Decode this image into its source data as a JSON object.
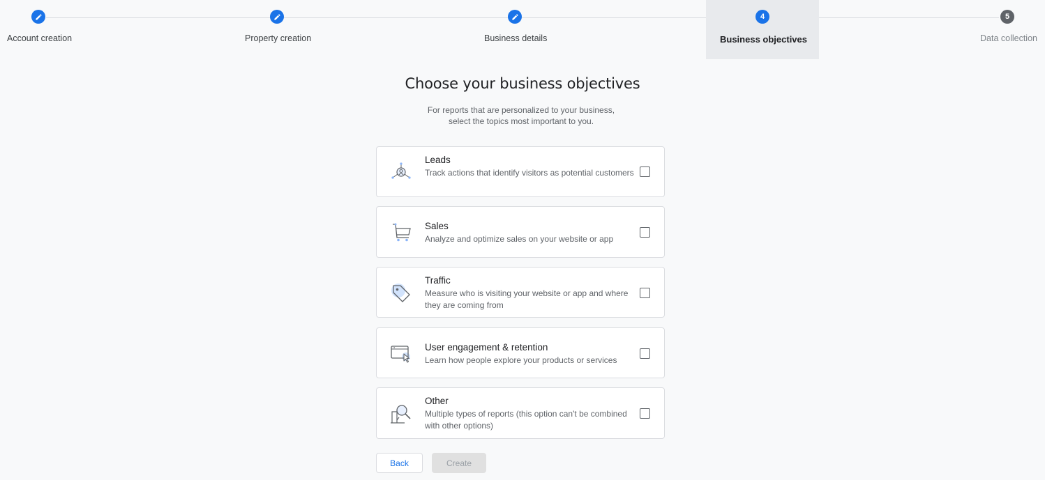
{
  "stepper": {
    "steps": [
      {
        "label": "Account creation",
        "status": "done",
        "icon": "pencil-icon"
      },
      {
        "label": "Property creation",
        "status": "done",
        "icon": "pencil-icon"
      },
      {
        "label": "Business details",
        "status": "done",
        "icon": "pencil-icon"
      },
      {
        "label": "Business objectives",
        "status": "current",
        "number": "4"
      },
      {
        "label": "Data collection",
        "status": "pending",
        "number": "5"
      }
    ]
  },
  "main": {
    "title": "Choose your business objectives",
    "subtitle_line1": "For reports that are personalized to your business,",
    "subtitle_line2": "select the topics most important to you."
  },
  "objectives": [
    {
      "title": "Leads",
      "description": "Track actions that identify visitors as potential customers",
      "icon": "leads-icon",
      "checked": false
    },
    {
      "title": "Sales",
      "description": "Analyze and optimize sales on your website or app",
      "icon": "shopping-cart-icon",
      "checked": false
    },
    {
      "title": "Traffic",
      "description": "Measure who is visiting your website or app and where they are coming from",
      "icon": "tag-icon",
      "checked": false
    },
    {
      "title": "User engagement & retention",
      "description": "Learn how people explore your products or services",
      "icon": "screen-cursor-icon",
      "checked": false
    },
    {
      "title": "Other",
      "description": "Multiple types of reports (this option can't be combined with other options)",
      "icon": "magnifier-icon",
      "checked": false
    }
  ],
  "actions": {
    "back_label": "Back",
    "create_label": "Create"
  },
  "colors": {
    "accent": "#1a73e8",
    "pending": "#5f6368",
    "background": "#f8f9fa"
  }
}
